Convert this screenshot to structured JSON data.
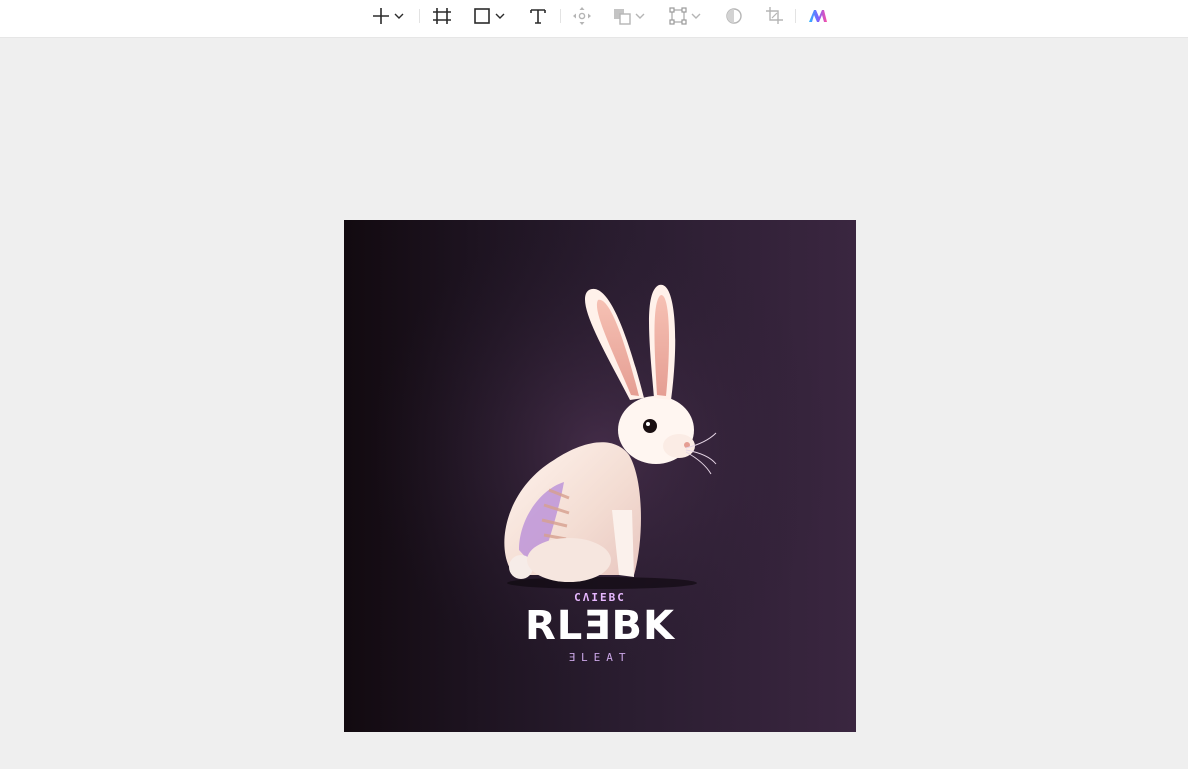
{
  "toolbar": {
    "tools": [
      {
        "name": "add-tool",
        "icon": "plus-icon",
        "has_dropdown": true
      },
      {
        "name": "frame-tool",
        "icon": "frame-icon",
        "has_dropdown": false
      },
      {
        "name": "shape-tool",
        "icon": "rectangle-icon",
        "has_dropdown": true
      },
      {
        "name": "text-tool",
        "icon": "text-icon",
        "has_dropdown": false
      },
      {
        "name": "move-tool",
        "icon": "move-icon",
        "has_dropdown": false
      },
      {
        "name": "boolean-tool",
        "icon": "boolean-union-icon",
        "has_dropdown": true
      },
      {
        "name": "component-tool",
        "icon": "component-icon",
        "has_dropdown": true
      },
      {
        "name": "mask-tool",
        "icon": "mask-circle-icon",
        "has_dropdown": false
      },
      {
        "name": "crop-tool",
        "icon": "crop-icon",
        "has_dropdown": false
      },
      {
        "name": "ai-tool",
        "icon": "ai-logo-icon",
        "has_dropdown": false
      }
    ]
  },
  "canvas": {
    "background": "#efefef",
    "artwork": {
      "subject": "white rabbit on dark purple gradient",
      "small_text": "CΛIEBC",
      "title_text": "RLƎBK",
      "sub_text": "ƎLEAT"
    }
  },
  "colors": {
    "accent": "#7b61ff",
    "toolbar_bg": "#ffffff",
    "icon": "#333333"
  }
}
